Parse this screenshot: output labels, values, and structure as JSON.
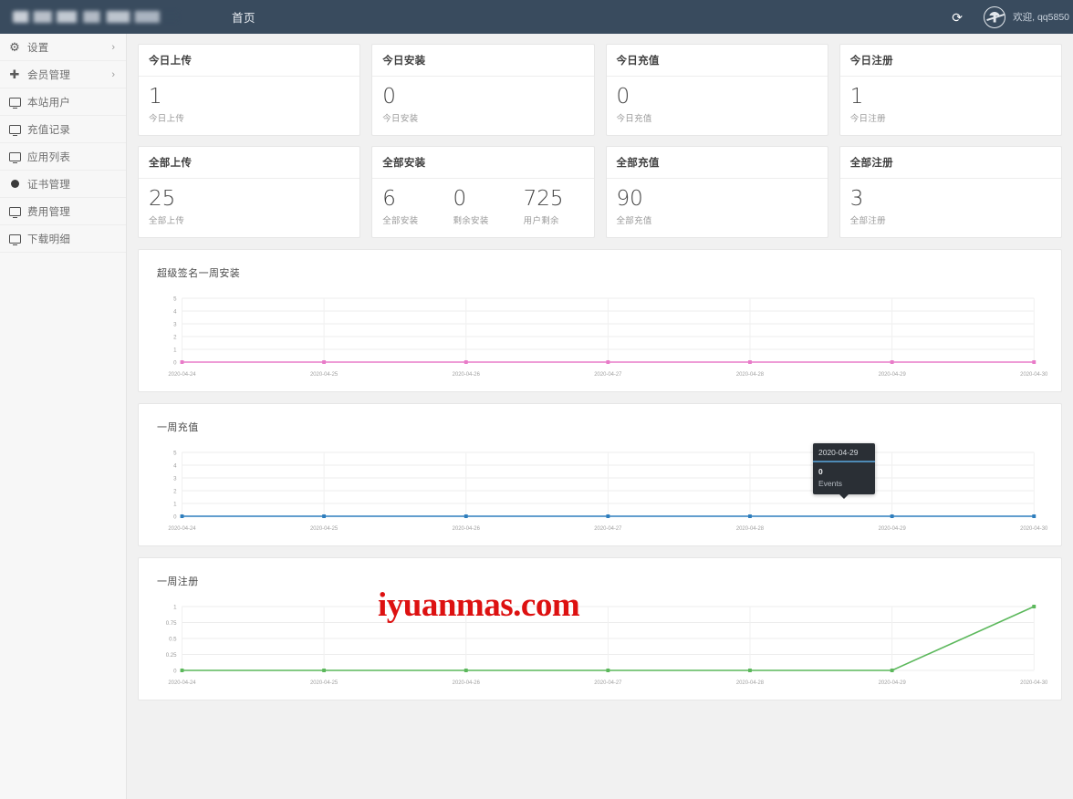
{
  "header": {
    "brand_logo": "blurred-logo",
    "nav_home": "首页",
    "refresh_icon": "refresh-icon",
    "avatar_icon": "user-avatar-icon",
    "welcome": "欢迎, qq5850"
  },
  "sidebar": {
    "items": [
      {
        "label": "设置",
        "icon": "gear-icon",
        "has_arrow": true,
        "arrow": "›"
      },
      {
        "label": "会员管理",
        "icon": "move-icon",
        "has_arrow": true,
        "arrow": "›"
      },
      {
        "label": "本站用户",
        "icon": "monitor-icon",
        "has_arrow": false,
        "arrow": ""
      },
      {
        "label": "充值记录",
        "icon": "monitor-icon",
        "has_arrow": false,
        "arrow": ""
      },
      {
        "label": "应用列表",
        "icon": "monitor-icon",
        "has_arrow": false,
        "arrow": ""
      },
      {
        "label": "证书管理",
        "icon": "dot-icon",
        "has_arrow": false,
        "arrow": ""
      },
      {
        "label": "费用管理",
        "icon": "monitor-icon",
        "has_arrow": false,
        "arrow": ""
      },
      {
        "label": "下载明细",
        "icon": "monitor-icon",
        "has_arrow": false,
        "arrow": ""
      }
    ]
  },
  "cards_row1": [
    {
      "title": "今日上传",
      "metrics": [
        {
          "value": "1",
          "label": "今日上传"
        }
      ]
    },
    {
      "title": "今日安装",
      "metrics": [
        {
          "value": "0",
          "label": "今日安装"
        }
      ]
    },
    {
      "title": "今日充值",
      "metrics": [
        {
          "value": "0",
          "label": "今日充值"
        }
      ]
    },
    {
      "title": "今日注册",
      "metrics": [
        {
          "value": "1",
          "label": "今日注册"
        }
      ]
    }
  ],
  "cards_row2": [
    {
      "title": "全部上传",
      "metrics": [
        {
          "value": "25",
          "label": "全部上传"
        }
      ]
    },
    {
      "title": "全部安装",
      "metrics": [
        {
          "value": "6",
          "label": "全部安装"
        },
        {
          "value": "0",
          "label": "剩余安装"
        },
        {
          "value": "725",
          "label": "用户剩余"
        }
      ]
    },
    {
      "title": "全部充值",
      "metrics": [
        {
          "value": "90",
          "label": "全部充值"
        }
      ]
    },
    {
      "title": "全部注册",
      "metrics": [
        {
          "value": "3",
          "label": "全部注册"
        }
      ]
    }
  ],
  "tooltip": {
    "date": "2020-04-29",
    "value": "0",
    "label": "Events"
  },
  "watermark": "iyuanmas.com",
  "colors": {
    "header_bg": "#394b5e",
    "page_bg": "#f1f1f1",
    "sidebar_bg": "#f7f7f7",
    "series_install": "#e87bc8",
    "series_recharge": "#2f7ebd",
    "series_register": "#5cb85c",
    "tooltip_bg": "#2a2f35",
    "tooltip_accent": "#4e8ab5",
    "watermark": "#dd1111"
  },
  "chart_data": [
    {
      "type": "line",
      "title": "超级签名一周安装",
      "xlabel": "",
      "ylabel": "",
      "categories": [
        "2020-04-24",
        "2020-04-25",
        "2020-04-26",
        "2020-04-27",
        "2020-04-28",
        "2020-04-29",
        "2020-04-30"
      ],
      "values": [
        0,
        0,
        0,
        0,
        0,
        0,
        0
      ],
      "yticks": [
        "0",
        "1",
        "2",
        "3",
        "4",
        "5"
      ],
      "ylim": [
        0,
        5
      ],
      "color": "#e87bc8",
      "grid": true,
      "legend": "none"
    },
    {
      "type": "line",
      "title": "一周充值",
      "xlabel": "",
      "ylabel": "",
      "categories": [
        "2020-04-24",
        "2020-04-25",
        "2020-04-26",
        "2020-04-27",
        "2020-04-28",
        "2020-04-29",
        "2020-04-30"
      ],
      "values": [
        0,
        0,
        0,
        0,
        0,
        0,
        0
      ],
      "yticks": [
        "0",
        "1",
        "2",
        "3",
        "4",
        "5"
      ],
      "ylim": [
        0,
        5
      ],
      "color": "#2f7ebd",
      "grid": true,
      "legend": "none",
      "hover_point": {
        "category": "2020-04-29",
        "value": 0,
        "series": "Events"
      }
    },
    {
      "type": "line",
      "title": "一周注册",
      "xlabel": "",
      "ylabel": "",
      "categories": [
        "2020-04-24",
        "2020-04-25",
        "2020-04-26",
        "2020-04-27",
        "2020-04-28",
        "2020-04-29",
        "2020-04-30"
      ],
      "values": [
        0,
        0,
        0,
        0,
        0,
        0,
        1
      ],
      "yticks": [
        "0",
        "0.25",
        "0.5",
        "0.75",
        "1"
      ],
      "ylim": [
        0,
        1
      ],
      "color": "#5cb85c",
      "grid": true,
      "legend": "none"
    }
  ]
}
